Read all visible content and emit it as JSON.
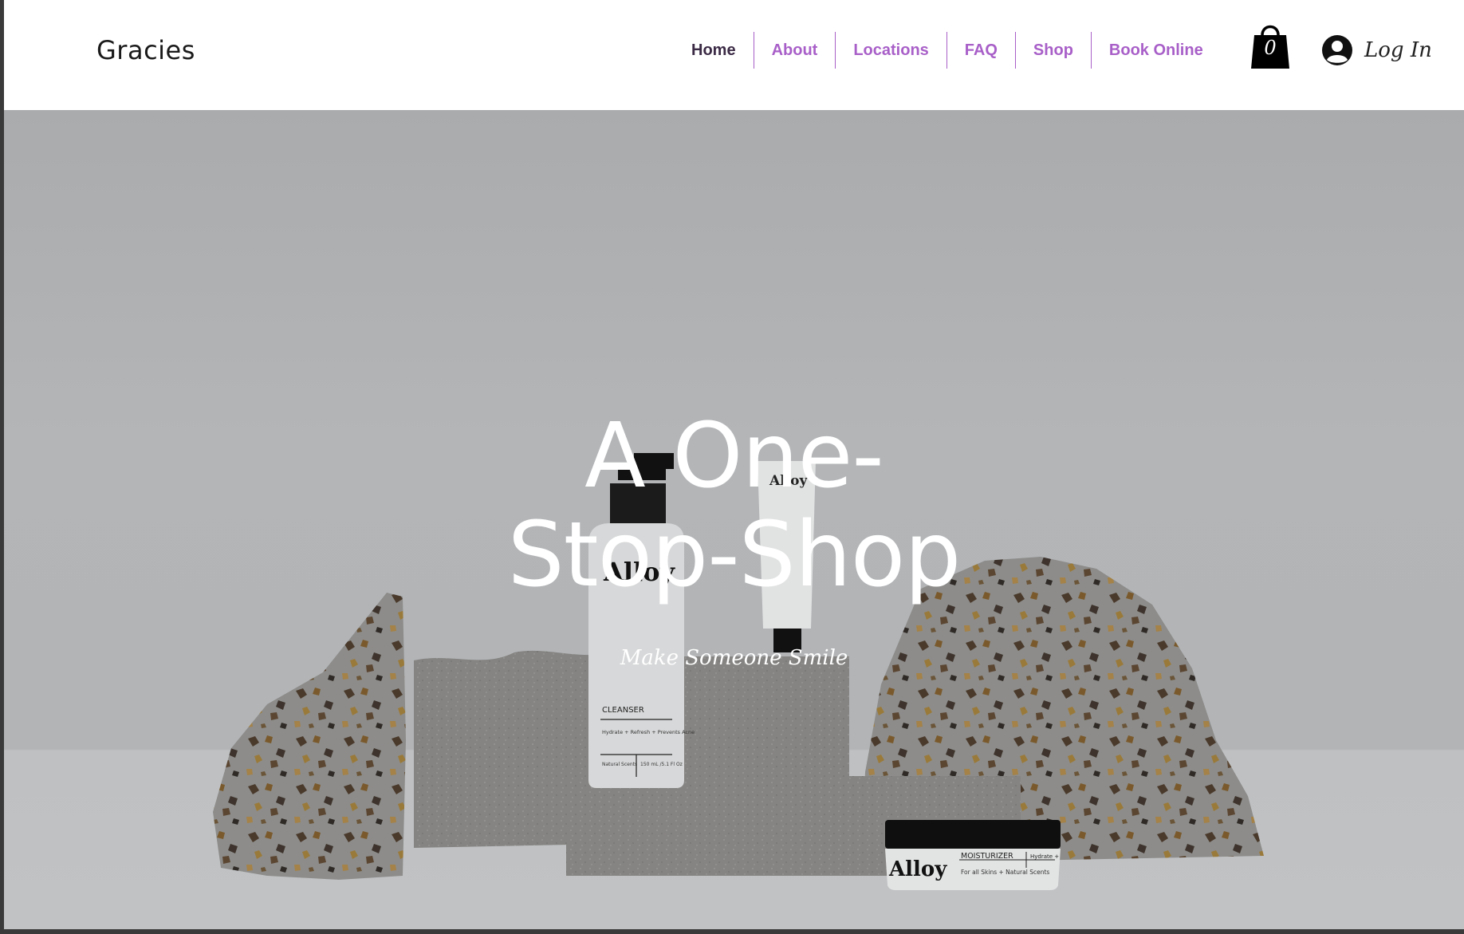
{
  "site": {
    "title": "Gracies"
  },
  "nav": {
    "items": [
      {
        "label": "Home"
      },
      {
        "label": "About"
      },
      {
        "label": "Locations"
      },
      {
        "label": "FAQ"
      },
      {
        "label": "Shop"
      },
      {
        "label": "Book Online"
      }
    ]
  },
  "cart": {
    "count": "0",
    "icon": "shopping-bag-icon"
  },
  "login": {
    "label": "Log In",
    "icon": "user-avatar-icon"
  },
  "hero": {
    "title": "A One-Stop-Shop",
    "subtitle": "Make Someone Smile",
    "products": {
      "cleanser_brand": "Alloy",
      "cleanser_name": "CLEANSER",
      "cleanser_desc": "Hydrate + Refresh + Prevents Acne",
      "cleanser_scent": "Natural Scents",
      "cleanser_size": "150 mL /5.1 Fl Oz",
      "tube_brand": "Alloy",
      "jar_brand": "Alloy",
      "jar_name": "MOISTURIZER",
      "jar_tag": "Hydrate +",
      "jar_desc": "For all Skins + Natural Scents"
    }
  },
  "colors": {
    "nav_active": "#3b2a45",
    "nav_link": "#a85fc8",
    "hero_bg": "#b2b4b6"
  }
}
